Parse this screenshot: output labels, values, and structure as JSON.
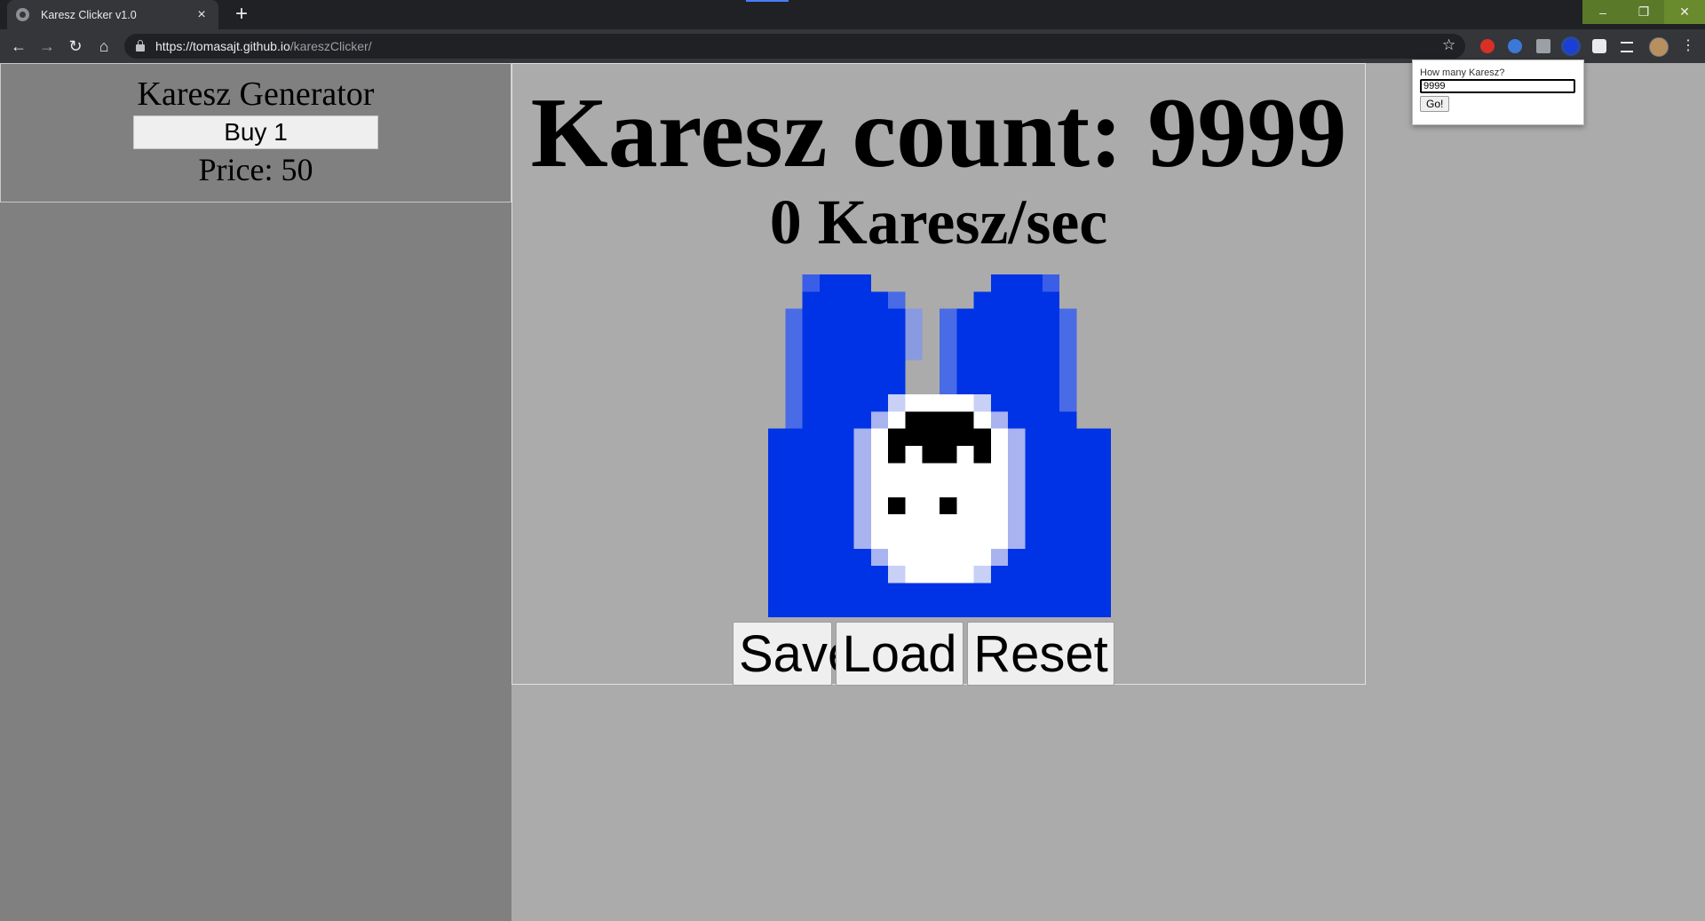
{
  "browser": {
    "tab_title": "Karesz Clicker v1.0",
    "tab_close": "×",
    "new_tab": "+",
    "url_host": "https://tomasajt.github.io",
    "url_path": "/kareszClicker/",
    "window_buttons": {
      "minimize": "–",
      "restore": "❐",
      "close": "✕"
    },
    "nav": {
      "back": "←",
      "forward": "→",
      "reload": "↻",
      "home": "⌂",
      "star": "☆",
      "menu": "⋮"
    },
    "extension_colors": [
      "#d93025",
      "#3c78d8",
      "#9aa0a6",
      "#1a3fd8",
      "#e8eaed",
      "#e8eaed"
    ],
    "extension_icons": [
      "adblock-icon",
      "sync-icon",
      "translate-icon",
      "karesz-extension-icon",
      "puzzle-extensions-icon",
      "reading-list-icon"
    ]
  },
  "sidebar": {
    "generator_title": "Karesz Generator",
    "buy_label": "Buy 1",
    "price_text": "Price: 50"
  },
  "game": {
    "count_text": "Karesz count: 9999",
    "rate_text": "0 Karesz/sec",
    "buttons": {
      "save": "Save",
      "load": "Load",
      "reset": "Reset"
    },
    "sprite_colors": {
      "body": "#0033e6",
      "face": "#ffffff",
      "eyes": "#000000"
    }
  },
  "popup": {
    "label": "How many Karesz?",
    "input_value": "9999",
    "go_label": "Go!"
  }
}
